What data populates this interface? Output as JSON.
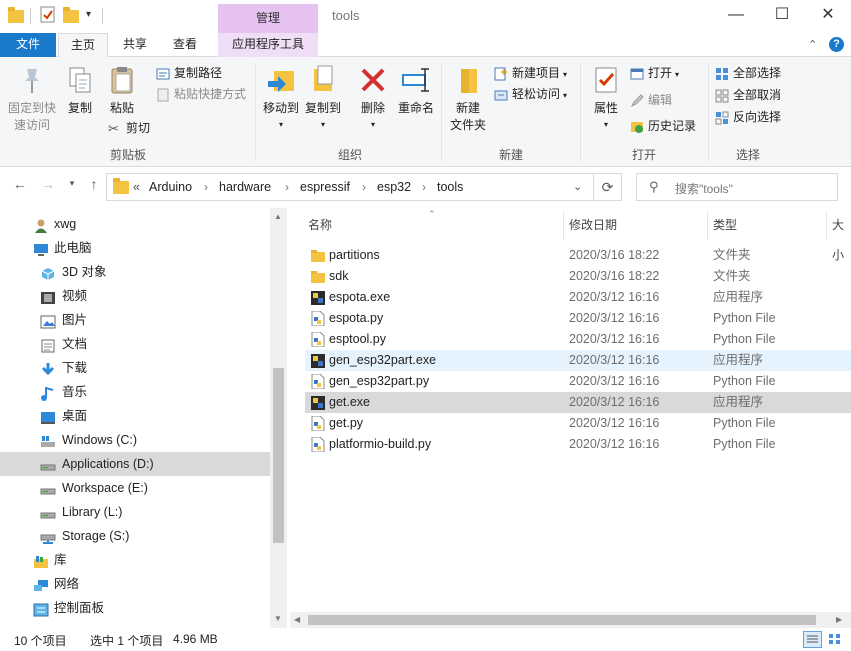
{
  "window": {
    "title": "tools",
    "context_tab": "管理",
    "controls": {
      "minimize": "—",
      "maximize": "☐",
      "close": "✕"
    }
  },
  "tabs": {
    "file": "文件",
    "home": "主页",
    "share": "共享",
    "view": "查看",
    "app_tools": "应用程序工具"
  },
  "ribbon": {
    "clipboard": {
      "pin_l1": "固定到快",
      "pin_l2": "速访问",
      "copy": "复制",
      "paste": "粘贴",
      "copy_path": "复制路径",
      "paste_shortcut": "粘贴快捷方式",
      "cut": "剪切",
      "label": "剪贴板"
    },
    "organize": {
      "move_to": "移动到",
      "copy_to": "复制到",
      "delete": "删除",
      "rename": "重命名",
      "label": "组织"
    },
    "new": {
      "new_folder_l1": "新建",
      "new_folder_l2": "文件夹",
      "new_item": "新建项目",
      "easy_access": "轻松访问",
      "label": "新建"
    },
    "open": {
      "properties": "属性",
      "open": "打开",
      "edit": "编辑",
      "history": "历史记录",
      "label": "打开"
    },
    "select": {
      "select_all": "全部选择",
      "select_none": "全部取消",
      "invert": "反向选择",
      "label": "选择"
    }
  },
  "address": {
    "prefix": "«",
    "crumbs": [
      "Arduino",
      "hardware",
      "espressif",
      "esp32",
      "tools"
    ],
    "search_placeholder": "搜索\"tools\""
  },
  "nav": {
    "items": [
      {
        "label": "xwg",
        "icon": "user-icon",
        "indent": 1
      },
      {
        "label": "此电脑",
        "icon": "computer-icon",
        "indent": 1
      },
      {
        "label": "3D 对象",
        "icon": "3d-objects-icon",
        "indent": 2
      },
      {
        "label": "视频",
        "icon": "video-icon",
        "indent": 2
      },
      {
        "label": "图片",
        "icon": "pictures-icon",
        "indent": 2
      },
      {
        "label": "文档",
        "icon": "documents-icon",
        "indent": 2
      },
      {
        "label": "下载",
        "icon": "download-icon",
        "indent": 2
      },
      {
        "label": "音乐",
        "icon": "music-icon",
        "indent": 2
      },
      {
        "label": "桌面",
        "icon": "desktop-icon",
        "indent": 2
      },
      {
        "label": "Windows (C:)",
        "icon": "windows-drive-icon",
        "indent": 2
      },
      {
        "label": "Applications (D:)",
        "icon": "drive-icon",
        "indent": 2
      },
      {
        "label": "Workspace (E:)",
        "icon": "drive-icon",
        "indent": 2
      },
      {
        "label": "Library (L:)",
        "icon": "drive-icon",
        "indent": 2
      },
      {
        "label": "Storage (S:)",
        "icon": "network-drive-icon",
        "indent": 2
      },
      {
        "label": "库",
        "icon": "library-icon",
        "indent": 1
      },
      {
        "label": "网络",
        "icon": "network-icon",
        "indent": 1
      },
      {
        "label": "控制面板",
        "icon": "control-panel-icon",
        "indent": 1
      }
    ]
  },
  "files": {
    "headers": {
      "name": "名称",
      "date": "修改日期",
      "type": "类型",
      "size": "大小"
    },
    "rows": [
      {
        "name": "partitions",
        "date": "2020/3/16 18:22",
        "type": "文件夹",
        "icon": "folder-icon"
      },
      {
        "name": "sdk",
        "date": "2020/3/16 18:22",
        "type": "文件夹",
        "icon": "folder-icon"
      },
      {
        "name": "espota.exe",
        "date": "2020/3/12 16:16",
        "type": "应用程序",
        "icon": "python-exe-icon"
      },
      {
        "name": "espota.py",
        "date": "2020/3/12 16:16",
        "type": "Python File",
        "icon": "python-file-icon"
      },
      {
        "name": "esptool.py",
        "date": "2020/3/12 16:16",
        "type": "Python File",
        "icon": "python-file-icon"
      },
      {
        "name": "gen_esp32part.exe",
        "date": "2020/3/12 16:16",
        "type": "应用程序",
        "icon": "python-exe-icon"
      },
      {
        "name": "gen_esp32part.py",
        "date": "2020/3/12 16:16",
        "type": "Python File",
        "icon": "python-file-icon"
      },
      {
        "name": "get.exe",
        "date": "2020/3/12 16:16",
        "type": "应用程序",
        "icon": "python-exe-icon"
      },
      {
        "name": "get.py",
        "date": "2020/3/12 16:16",
        "type": "Python File",
        "icon": "python-file-icon"
      },
      {
        "name": "platformio-build.py",
        "date": "2020/3/12 16:16",
        "type": "Python File",
        "icon": "python-file-icon"
      }
    ]
  },
  "status": {
    "count": "10 个项目",
    "selected": "选中 1 个项目",
    "size": "4.96 MB"
  },
  "colors": {
    "accent": "#1979ca",
    "context_tab": "#e6c2f0",
    "hover_row": "#e5f3ff",
    "selected_row": "#d9d9d9",
    "folder": "#f5c342"
  }
}
